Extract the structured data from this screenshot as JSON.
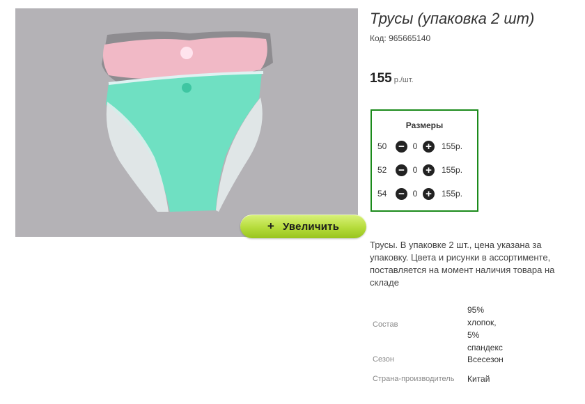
{
  "zoom_button": {
    "label": "Увеличить",
    "icon": "plus-icon"
  },
  "product": {
    "title": "Трусы (упаковка 2 шт)",
    "sku": "Код: 965665140",
    "price": "155",
    "price_unit": "р./шт.",
    "description": "Трусы. В упаковке 2 шт., цена указана за упаковку. Цвета и рисунки в ассортименте, поставляется на момент наличия товара на складе"
  },
  "sizes": {
    "title": "Размеры",
    "items": [
      {
        "size": "50",
        "qty": "0",
        "price": "155р."
      },
      {
        "size": "52",
        "qty": "0",
        "price": "155р."
      },
      {
        "size": "54",
        "qty": "0",
        "price": "155р."
      }
    ],
    "minus_icon": "minus-circle-icon",
    "plus_icon": "plus-circle-icon"
  },
  "attributes": {
    "composition_label": "Состав",
    "composition_lines": [
      "95%",
      "хлопок,",
      "5%",
      "спандекс"
    ],
    "season_label": "Сезон",
    "season_value": "Всесезон",
    "country_label": "Страна-производитель",
    "country_value": "Китай"
  },
  "colors": {
    "border_green": "#1a8a1a",
    "button_green": "#b6dc3c",
    "image_background": "#b4b2b6"
  }
}
